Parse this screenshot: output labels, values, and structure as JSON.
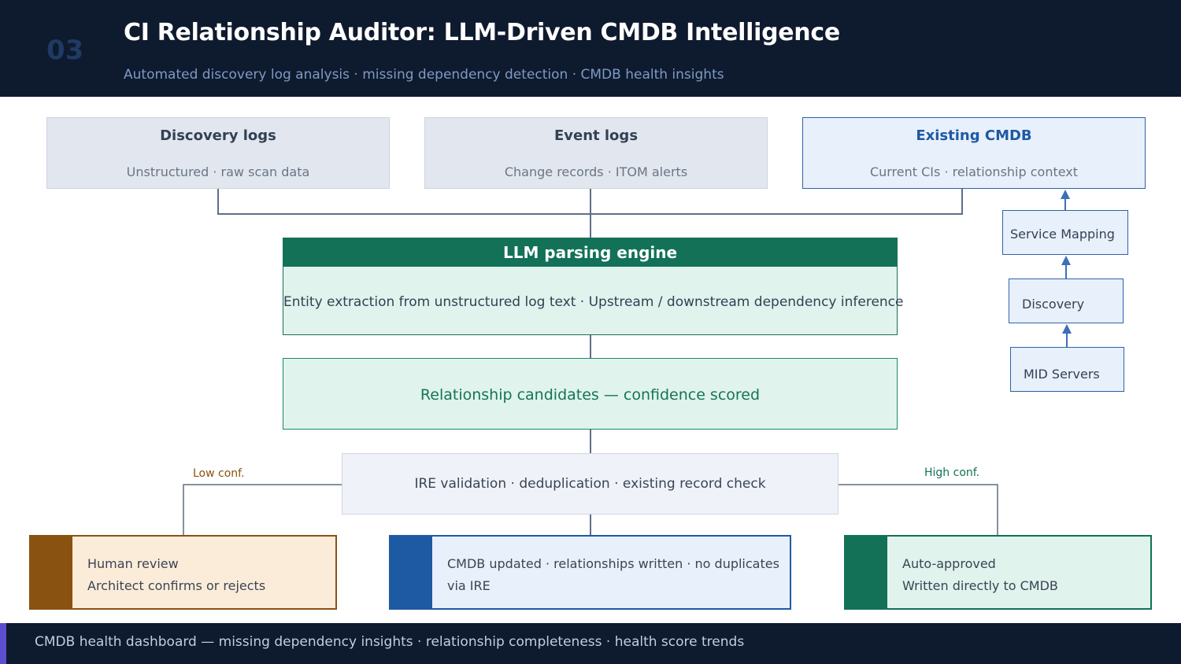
{
  "header": {
    "slide_number": "03",
    "title": "CI Relationship Auditor: LLM-Driven CMDB Intelligence",
    "subtitle": "Automated discovery log analysis · missing dependency detection · CMDB health insights"
  },
  "sources": [
    {
      "title": "Discovery logs",
      "subtitle": "Unstructured · raw scan data"
    },
    {
      "title": "Event logs",
      "subtitle": "Change records · ITOM alerts"
    },
    {
      "title": "Existing CMDB",
      "subtitle": "Current CIs · relationship context"
    }
  ],
  "engine": {
    "title": "LLM parsing engine",
    "body": "Entity extraction from unstructured log text  ·  Upstream / downstream dependency inference"
  },
  "candidates": {
    "text": "Relationship candidates  —  confidence scored"
  },
  "validation": {
    "text": "IRE validation  ·  deduplication · existing record check"
  },
  "branch_labels": {
    "low": "Low conf.",
    "high": "High conf."
  },
  "outcomes": [
    {
      "line1": "Human review",
      "line2": "Architect confirms or rejects",
      "color": "#8a5210",
      "bg": "#fbecd9"
    },
    {
      "line1": "CMDB updated  ·  relationships written · no duplicates",
      "line2": "via IRE",
      "color": "#1e5aa3",
      "bg": "#e8f0fb"
    },
    {
      "line1": "Auto-approved",
      "line2": "Written directly to CMDB",
      "color": "#127157",
      "bg": "#e0f3ec"
    }
  ],
  "side_chain": [
    {
      "label": "Service Mapping"
    },
    {
      "label": "Discovery"
    },
    {
      "label": "MID Servers"
    }
  ],
  "footer": {
    "text": "CMDB health dashboard  —  missing dependency insights · relationship completeness · health score trends"
  },
  "colors": {
    "header_bg": "#0e1a2e",
    "engine_green": "#127157",
    "cmdb_blue": "#1e5aa3",
    "low_conf": "#8a5210",
    "high_conf": "#127157",
    "footer_accent": "#5b4fcf"
  }
}
